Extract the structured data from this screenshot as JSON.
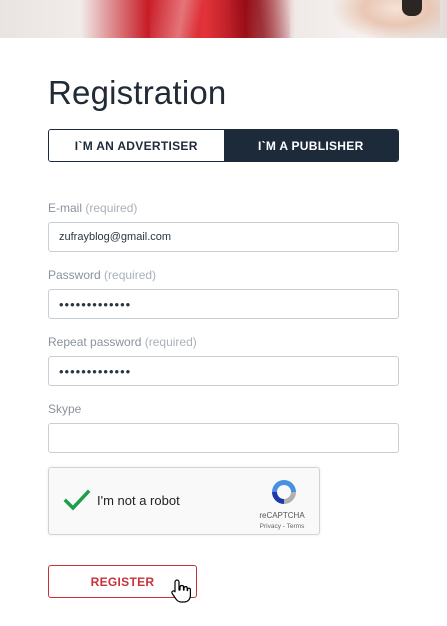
{
  "page": {
    "title": "Registration",
    "accent_color": "#c9313a",
    "dark_color": "#1d2a39"
  },
  "tabs": [
    {
      "label": "I`M AN ADVERTISER",
      "active": false
    },
    {
      "label": "I`M A PUBLISHER",
      "active": true
    }
  ],
  "form": {
    "email": {
      "label": "E-mail",
      "required": "(required)",
      "value": "zufrayblog@gmail.com"
    },
    "password": {
      "label": "Password",
      "required": "(required)",
      "value": "•••••••••••••"
    },
    "repeat_password": {
      "label": "Repeat password",
      "required": "(required)",
      "value": "•••••••••••••"
    },
    "skype": {
      "label": "Skype",
      "value": ""
    }
  },
  "captcha": {
    "checked": true,
    "text": "I'm not a robot",
    "brand": "reCAPTCHA",
    "links": "Privacy - Terms"
  },
  "register_label": "REGISTER"
}
